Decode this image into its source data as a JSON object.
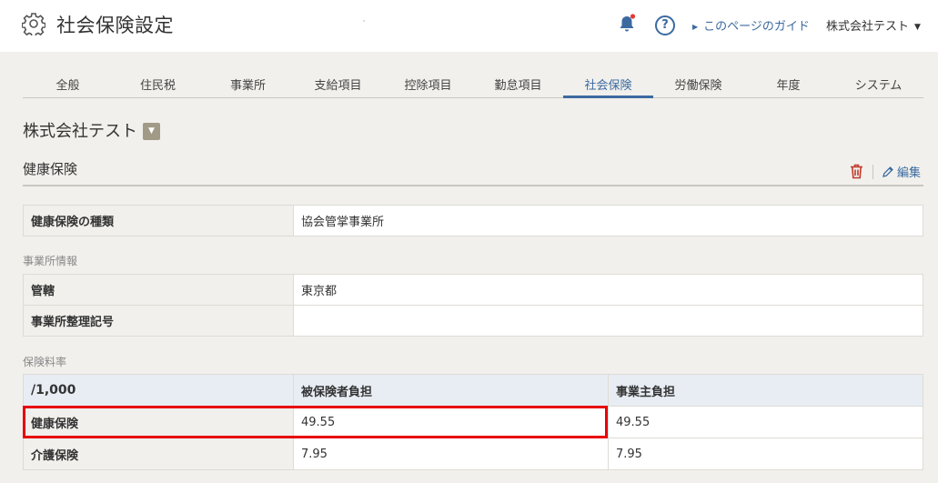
{
  "header": {
    "title": "社会保険設定",
    "guide_label": "このページのガイド",
    "help_label": "?",
    "company_menu": "株式会社テスト"
  },
  "tabs": [
    {
      "label": "全般"
    },
    {
      "label": "住民税"
    },
    {
      "label": "事業所"
    },
    {
      "label": "支給項目"
    },
    {
      "label": "控除項目"
    },
    {
      "label": "勤怠項目"
    },
    {
      "label": "社会保険",
      "active": true
    },
    {
      "label": "労働保険"
    },
    {
      "label": "年度"
    },
    {
      "label": "システム"
    }
  ],
  "company": {
    "name": "株式会社テスト"
  },
  "section": {
    "title": "健康保険",
    "edit_label": "編集"
  },
  "insurance_type": {
    "label": "健康保険の種類",
    "value": "協会管掌事業所"
  },
  "office_info": {
    "heading": "事業所情報",
    "rows": [
      {
        "label": "管轄",
        "value": "東京都"
      },
      {
        "label": "事業所整理記号",
        "value": ""
      }
    ]
  },
  "rates": {
    "heading": "保険料率",
    "columns": [
      "/1,000",
      "被保険者負担",
      "事業主負担"
    ],
    "rows": [
      {
        "label": "健康保険",
        "insured": "49.55",
        "employer": "49.55"
      },
      {
        "label": "介護保険",
        "insured": "7.95",
        "employer": "7.95"
      }
    ]
  },
  "colors": {
    "accent": "#3c6aa0",
    "highlight": "#e8000b",
    "notification_dot": "#e53935",
    "trash": "#c0392b"
  }
}
